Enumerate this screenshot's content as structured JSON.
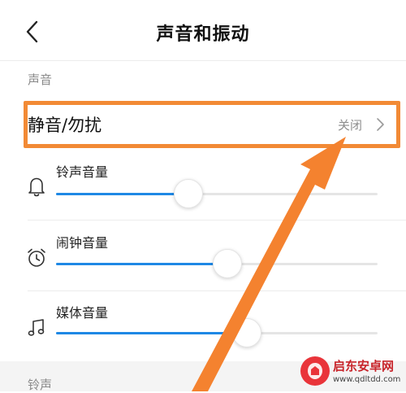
{
  "header": {
    "title": "声音和振动",
    "back_icon": "chevron-left-icon"
  },
  "sections": {
    "sound_label": "声音",
    "ringtone_label": "铃声"
  },
  "dnd": {
    "label": "静音/勿扰",
    "value": "关闭",
    "chevron_icon": "chevron-right-icon"
  },
  "volumes": [
    {
      "label": "铃声音量",
      "icon": "bell-icon",
      "level": 0.41
    },
    {
      "label": "闹钟音量",
      "icon": "alarm-clock-icon",
      "level": 0.53
    },
    {
      "label": "媒体音量",
      "icon": "music-note-icon",
      "level": 0.59
    }
  ],
  "annotation": {
    "highlight_color": "#f28a35",
    "arrow_color": "#f4822f"
  },
  "accent_color": "#1e88e5",
  "watermark": {
    "title": "启东安卓网",
    "url": "www.qdltdd.com"
  }
}
